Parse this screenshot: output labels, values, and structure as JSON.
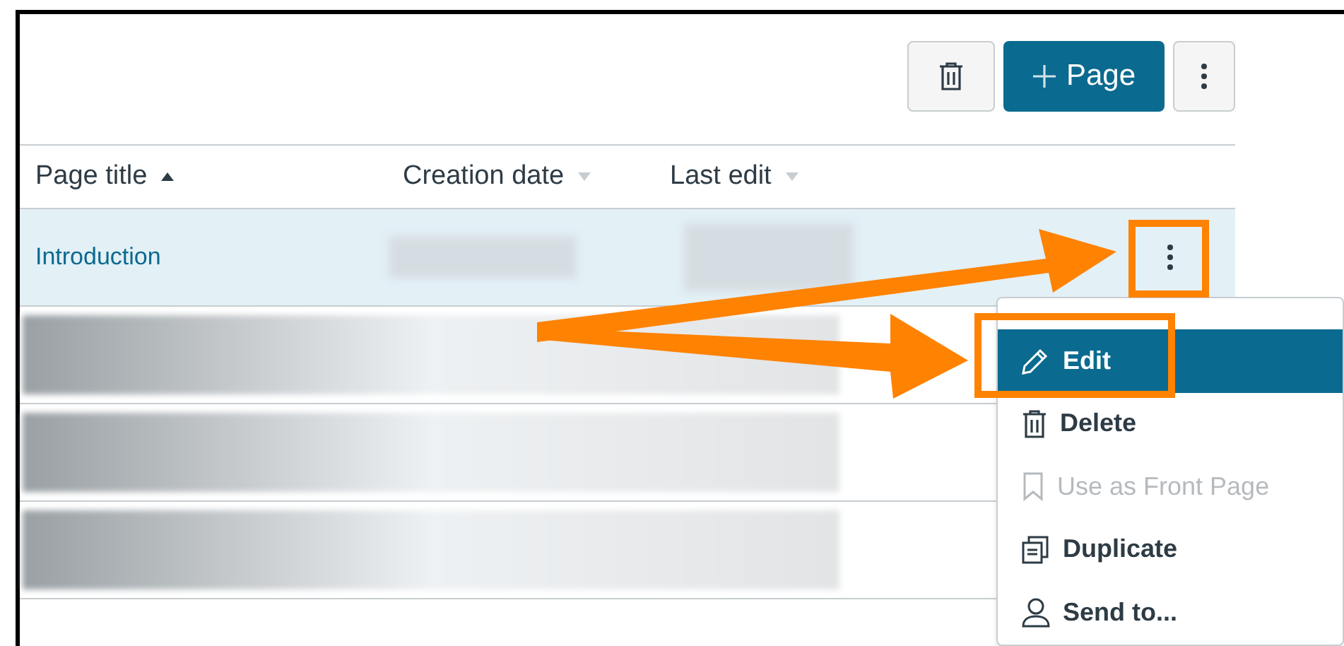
{
  "toolbar": {
    "delete_button": {
      "kind": "icon"
    },
    "add_button": {
      "label": "Page"
    },
    "more_button": {
      "kind": "icon"
    }
  },
  "table": {
    "columns": [
      {
        "label": "Page title",
        "sorted": true
      },
      {
        "label": "Creation date",
        "sorted": false
      },
      {
        "label": "Last edit",
        "sorted": false
      }
    ],
    "rows": [
      {
        "title": "Introduction",
        "selected": true
      },
      {
        "selected": false
      },
      {
        "selected": false
      },
      {
        "selected": false
      }
    ]
  },
  "menu": {
    "items": [
      {
        "label": "Edit",
        "selected": true,
        "disabled": false
      },
      {
        "label": "Delete",
        "selected": false,
        "disabled": false
      },
      {
        "label": "Use as Front Page",
        "selected": false,
        "disabled": true
      },
      {
        "label": "Duplicate",
        "selected": false,
        "disabled": false
      },
      {
        "label": "Send to...",
        "selected": false,
        "disabled": false
      }
    ]
  }
}
